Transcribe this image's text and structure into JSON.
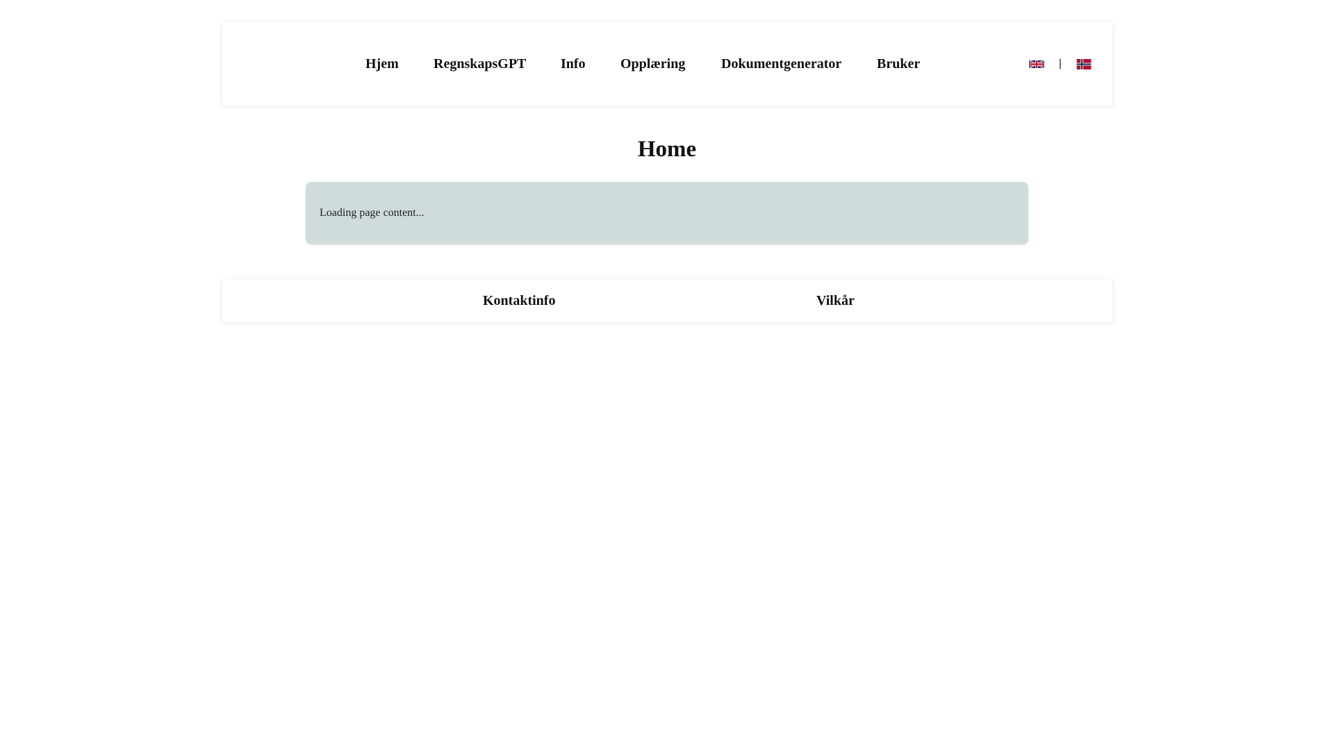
{
  "nav": {
    "items": [
      {
        "label": "Hjem"
      },
      {
        "label": "RegnskapsGPT"
      },
      {
        "label": "Info"
      },
      {
        "label": "Opplæring"
      },
      {
        "label": "Dokumentgenerator"
      },
      {
        "label": "Bruker"
      }
    ],
    "language_separator": "|",
    "languages": [
      {
        "icon": "uk-flag-icon"
      },
      {
        "icon": "norway-flag-icon"
      }
    ]
  },
  "main": {
    "title": "Home",
    "status_text": "Loading page content...",
    "status_bg_color": "#cfdcdb"
  },
  "footer": {
    "links": [
      {
        "label": "Kontaktinfo"
      },
      {
        "label": "Vilkår"
      }
    ]
  }
}
